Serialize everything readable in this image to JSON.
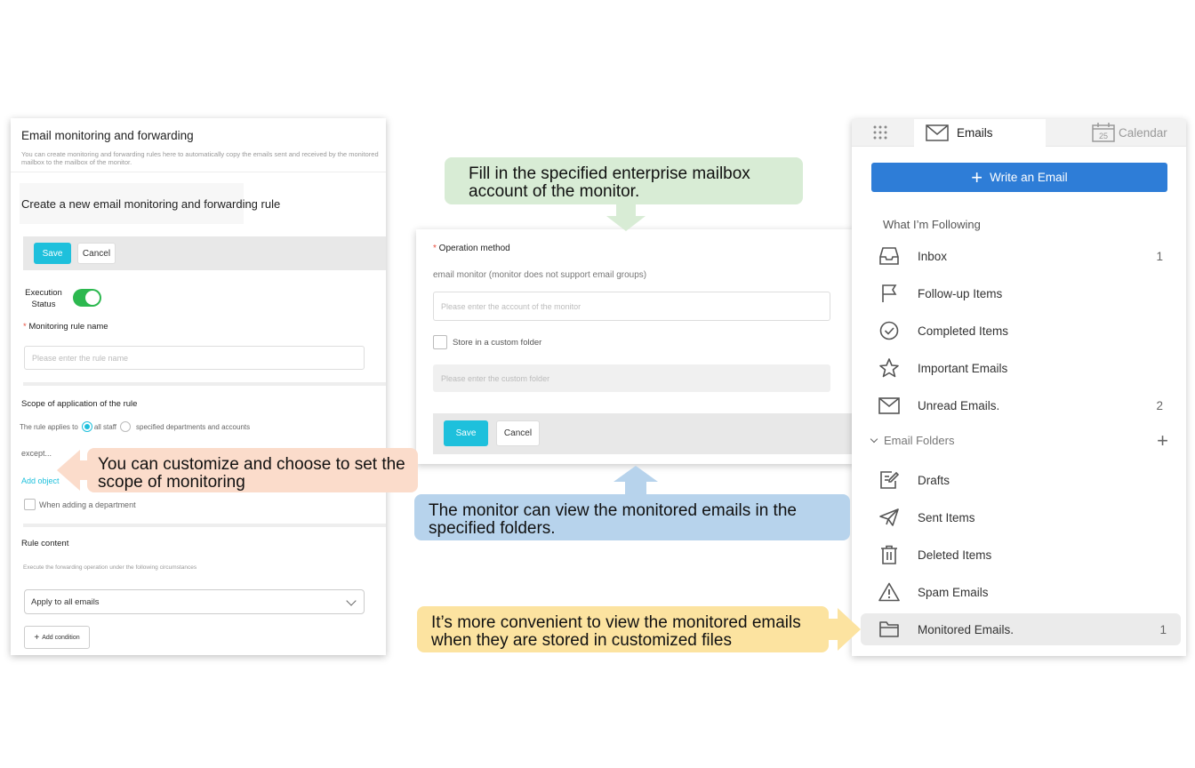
{
  "left_panel": {
    "title": "Email monitoring and forwarding",
    "description": "You can create monitoring and forwarding rules here to automatically copy the emails sent and received by the monitored mailbox to the mailbox of the monitor.",
    "subtitle": "Create a new email monitoring and forwarding rule",
    "save_label": "Save",
    "cancel_label": "Cancel",
    "execution_status_label": "Execution Status",
    "execution_status_on": true,
    "rule_name_label": "Monitoring rule name",
    "rule_name_placeholder": "Please enter the rule name",
    "scope_title": "Scope of application of the rule",
    "scope_prefix": "The rule applies to",
    "scope_option_all": "all staff",
    "scope_option_specified": "specified departments and accounts",
    "except_label": "except...",
    "add_object_label": "Add object",
    "when_adding_department_label": "When adding a department",
    "rule_content_title": "Rule content",
    "rule_content_desc": "Execute the forwarding operation under the following circumstances",
    "apply_select_value": "Apply to all emails",
    "add_condition_label": "Add condition"
  },
  "middle_panel": {
    "operation_method_label": "Operation method",
    "operation_desc": "email monitor (monitor does not support email groups)",
    "monitor_account_placeholder": "Please enter the account of the monitor",
    "store_custom_folder_label": "Store in a custom folder",
    "custom_folder_placeholder": "Please enter the custom folder",
    "save_label": "Save",
    "cancel_label": "Cancel"
  },
  "right_panel": {
    "tab_emails": "Emails",
    "tab_calendar": "Calendar",
    "calendar_day": "25",
    "write_button": "Write an Email",
    "following_title": "What I’m Following",
    "following_items": [
      {
        "label": "Inbox",
        "count": "1",
        "icon": "inbox-icon"
      },
      {
        "label": "Follow-up Items",
        "count": "",
        "icon": "flag-icon"
      },
      {
        "label": "Completed Items",
        "count": "",
        "icon": "check-circle-icon"
      },
      {
        "label": "Important Emails",
        "count": "",
        "icon": "star-icon"
      },
      {
        "label": "Unread Emails.",
        "count": "2",
        "icon": "envelope-icon"
      }
    ],
    "folders_title": "Email Folders",
    "folder_items": [
      {
        "label": "Drafts",
        "count": "",
        "icon": "draft-icon"
      },
      {
        "label": "Sent Items",
        "count": "",
        "icon": "paper-plane-icon"
      },
      {
        "label": "Deleted Items",
        "count": "",
        "icon": "trash-icon"
      },
      {
        "label": "Spam Emails",
        "count": "",
        "icon": "warning-icon"
      },
      {
        "label": "Monitored Emails.",
        "count": "1",
        "icon": "folder-icon"
      }
    ]
  },
  "callouts": {
    "green": "Fill in the specified enterprise mailbox account of the monitor.",
    "peach": "You can customize and choose to set the scope of monitoring",
    "blue": "The monitor can view the monitored emails in the specified folders.",
    "yellow": "It’s more convenient to view the monitored emails when they are stored in customized files"
  },
  "colors": {
    "save_button": "#1ec0dc",
    "toggle_on": "#2cb84f",
    "write_button": "#2e7dd7",
    "callout_green": "#d8ecd5",
    "callout_peach": "#fbdccb",
    "callout_blue": "#b7d3ec",
    "callout_yellow": "#fce3a0"
  }
}
